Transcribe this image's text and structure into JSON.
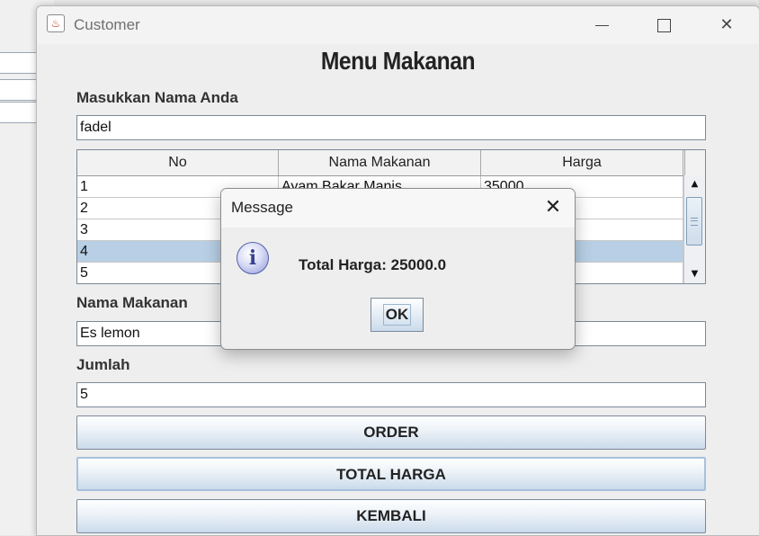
{
  "window": {
    "title": "Customer",
    "app_icon": "java-cup-icon"
  },
  "form": {
    "heading": "Menu Makanan",
    "name_label": "Masukkan Nama Anda",
    "name_value": "fadel",
    "food_label": "Nama Makanan",
    "food_value": "Es lemon",
    "qty_label": "Jumlah",
    "qty_value": "5"
  },
  "table": {
    "headers": [
      "No",
      "Nama Makanan",
      "Harga"
    ],
    "rows": [
      [
        "1",
        "Ayam Bakar Manis",
        "35000"
      ],
      [
        "2",
        "",
        ""
      ],
      [
        "3",
        "",
        ""
      ],
      [
        "4",
        "",
        ""
      ],
      [
        "5",
        "",
        ""
      ]
    ],
    "selected_row": 4
  },
  "buttons": {
    "order": "ORDER",
    "total": "TOTAL HARGA",
    "back": "KEMBALI"
  },
  "dialog": {
    "title": "Message",
    "message": "Total Harga: 25000.0",
    "ok": "OK",
    "icon": "info-icon"
  },
  "colors": {
    "selection": "#b8cfe5",
    "button_gradient_end": "#cbdbeb"
  }
}
